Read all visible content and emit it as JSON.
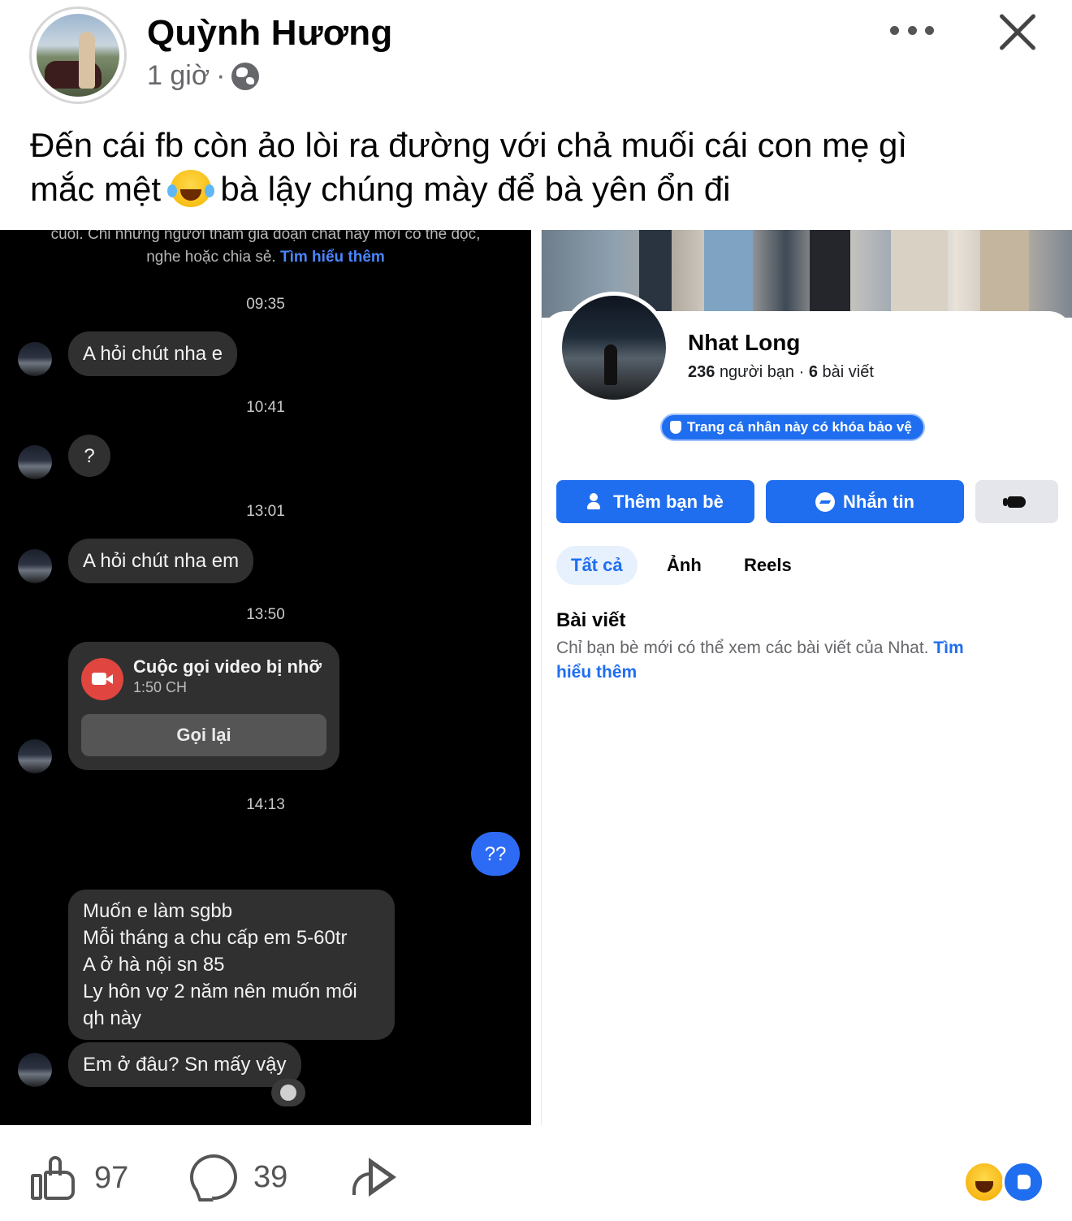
{
  "post": {
    "author": "Quỳnh Hương",
    "time": "1 giờ",
    "separator": "·",
    "privacy_icon": "globe-icon",
    "text_line1": "Đến cái fb còn ảo lòi ra đường với chả muối cái con mẹ gì",
    "text_line2_before": "mắc mệt",
    "text_line2_after": "bà lậy chúng mày để bà yên ổn đi",
    "inline_emoji": "face-with-tears-of-joy"
  },
  "chat": {
    "notice_line1": "cuối. Chỉ những người tham gia đoạn chat này mới có thể đọc,",
    "notice_line2": "nghe hoặc chia sẻ.",
    "notice_link": "Tìm hiểu thêm",
    "timestamps": [
      "09:35",
      "10:41",
      "13:01",
      "13:50",
      "14:13"
    ],
    "messages": {
      "m1": "A hỏi chút nha e",
      "m2": "?",
      "m3": "A hỏi chút nha em",
      "mine": "??",
      "long_1": "Muốn e làm sgbb",
      "long_2": "Mỗi tháng a chu cấp em 5-60tr",
      "long_3": "A ở hà nội sn 85",
      "long_4": "Ly hôn vợ 2 năm nên muốn mối",
      "long_5": "qh này",
      "last": "Em ở đâu? Sn mấy vậy"
    },
    "missed_call": {
      "title": "Cuộc gọi video bị nhỡ",
      "time": "1:50 CH",
      "button": "Gọi lại"
    }
  },
  "profile": {
    "name": "Nhat Long",
    "friends_count": "236",
    "friends_label": "người bạn",
    "dot": "·",
    "posts_count": "6",
    "posts_label": "bài viết",
    "locked_badge": "Trang cá nhân này có khóa bảo vệ",
    "add_friend": "Thêm bạn bè",
    "message": "Nhắn tin",
    "tabs": [
      "Tất cả",
      "Ảnh",
      "Reels"
    ],
    "section_title": "Bài viết",
    "section_desc": "Chỉ bạn bè mới có thể xem các bài viết của Nhat.",
    "section_link_1": "Tìm",
    "section_link_2": "hiểu thêm"
  },
  "footer": {
    "likes": "97",
    "comments": "39"
  },
  "colors": {
    "accent": "#1f6ef0",
    "messenger_blue": "#2e6bf5",
    "chat_bg": "#000000",
    "bubble_bg": "#303030",
    "missed_call_red": "#e0463f"
  }
}
